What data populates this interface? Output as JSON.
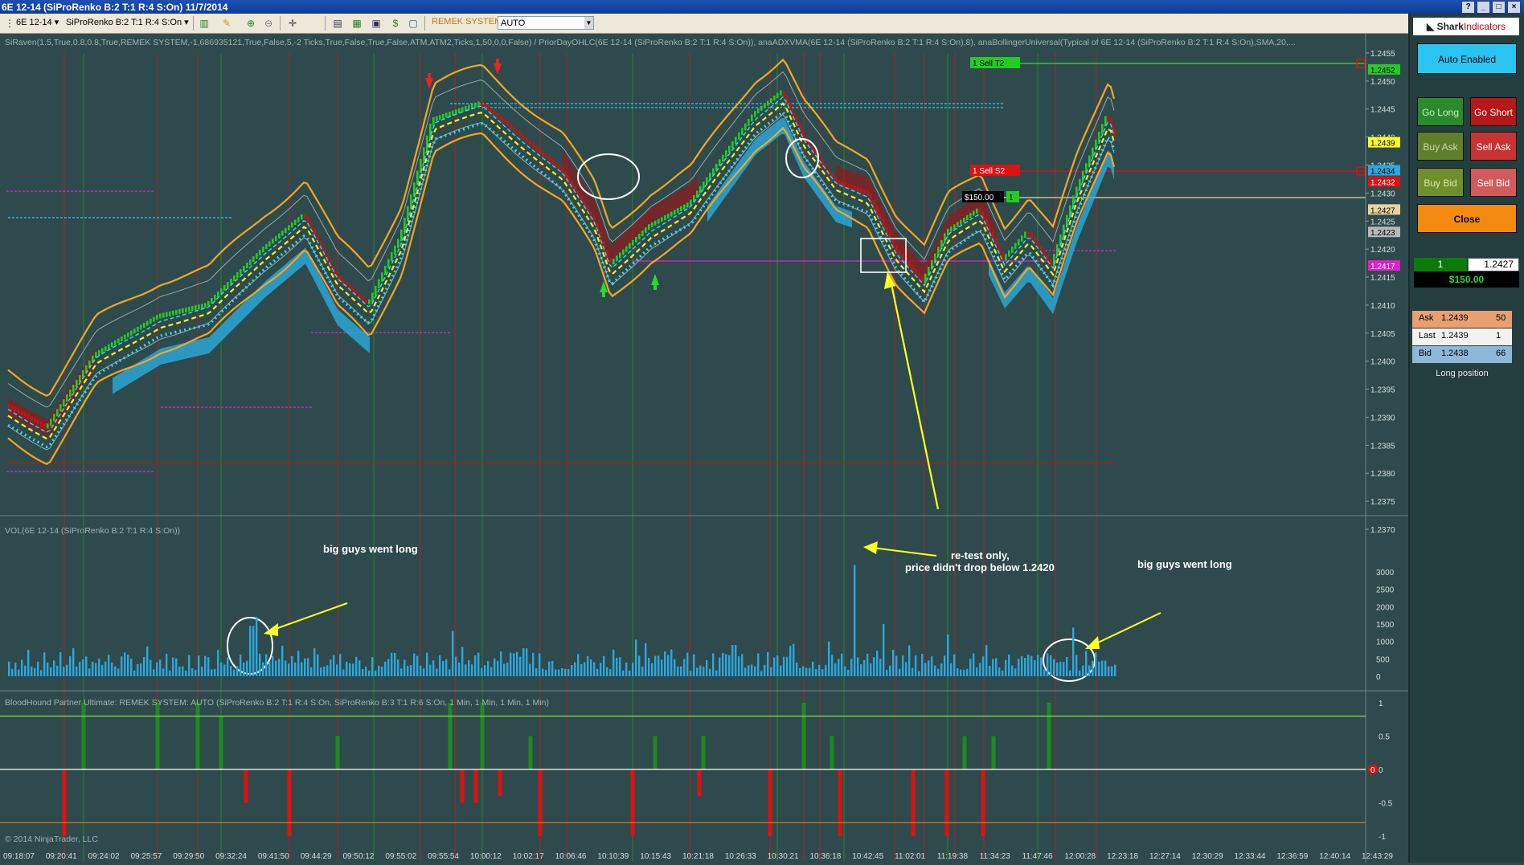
{
  "window": {
    "title": "6E 12-14 (SiProRenko B:2 T:1 R:4 S:On)  11/7/2014",
    "buttons": [
      "?",
      "_",
      "□",
      "×"
    ]
  },
  "toolbar": {
    "instrument": "6E 12-14",
    "chart_type": "SiProRenko B:2 T:1 R:4 S:On",
    "strategy": "REMEK SYSTEM",
    "mode": "AUTO"
  },
  "chart": {
    "indicator_label": "SiRaven(1.5,True,0.8,0.8,True,REMEK SYSTEM,-1,686935121,True,False,5,-2 Ticks,True,False,True,False,ATM,ATM2,Ticks,1,50,0,0,False) / PriorDayOHLC(6E 12-14 (SiProRenko B:2 T:1 R:4 S:On)), anaADXVMA(6E 12-14 (SiProRenko B:2 T:1 R:4 S:On),8), anaBollingerUniversal(Typical of 6E 12-14 (SiProRenko B:2 T:1 R:4 S:On),SMA,20,...",
    "vol_label": "VOL(6E 12-14 (SiProRenko B:2 T:1 R:4 S:On))",
    "bh_label": "BloodHound Partner Ultimate: REMEK SYSTEM: AUTO (SiProRenko B:2 T:1 R:4 S:On, SiProRenko B:3 T:1 R:6 S:On, 1 Min, 1 Min, 1 Min, 1 Min)",
    "copyright": "© 2014 NinjaTrader, LLC",
    "price_ticks": [
      "1.2455",
      "1.2450",
      "1.2445",
      "1.2440",
      "1.2435",
      "1.2430",
      "1.2425",
      "1.2420",
      "1.2415",
      "1.2410",
      "1.2405",
      "1.2400",
      "1.2395",
      "1.2390",
      "1.2385",
      "1.2380",
      "1.2375",
      "1.2370"
    ],
    "price_badges": [
      {
        "value": "1.2452",
        "bg": "#22cc22",
        "fg": "#000"
      },
      {
        "value": "1.2439",
        "bg": "#ffff22",
        "fg": "#000"
      },
      {
        "value": "1.2434",
        "bg": "#2aa8e0",
        "fg": "#000"
      },
      {
        "value": "1.2432",
        "bg": "#dd1111",
        "fg": "#fff"
      },
      {
        "value": "1.2427",
        "bg": "#e8d3a0",
        "fg": "#000"
      },
      {
        "value": "1.2423",
        "bg": "#b8b8b8",
        "fg": "#000"
      },
      {
        "value": "1.2417",
        "bg": "#e020d0",
        "fg": "#fff"
      }
    ],
    "orders": {
      "t2": {
        "qty": "1",
        "label": "Sell T2"
      },
      "s2": {
        "qty": "1",
        "label": "Sell S2"
      },
      "pnl": "$150.00",
      "entry_qty": "1"
    },
    "vol_ticks": [
      "3000",
      "2500",
      "2000",
      "1500",
      "1000",
      "500",
      "0"
    ],
    "bh_ticks": [
      "1",
      "0.5",
      "0",
      "-0.5",
      "-1"
    ],
    "bh_zero_badge": "0",
    "time_labels": [
      "09:18:07",
      "09:20:41",
      "09:24:02",
      "09:25:57",
      "09:29:50",
      "09:32:24",
      "09:41:50",
      "09:44:29",
      "09:50:12",
      "09:55:02",
      "09:55:54",
      "10:00:12",
      "10:02:17",
      "10:06:46",
      "10:10:39",
      "10:15:43",
      "10:21:18",
      "10:26:33",
      "10:30:21",
      "10:36:18",
      "10:42:45",
      "11:02:01",
      "11:19:38",
      "11:34:23",
      "11:47:46",
      "12:00:28",
      "12:23:18",
      "12:27:14",
      "12:30:29",
      "12:33:44",
      "12:36:59",
      "12:40:14",
      "12:43:29"
    ],
    "annotations": {
      "big_guys_1": "big guys went long",
      "big_guys_2": "big guys went long",
      "retest_1": "re-test only,",
      "retest_2": "price didn't drop below 1.2420"
    }
  },
  "panel": {
    "logo_main": "Shark",
    "logo_sub": "Indicators",
    "auto_enabled": "Auto Enabled",
    "go_long": "Go Long",
    "go_short": "Go Short",
    "buy_ask": "Buy Ask",
    "sell_ask": "Sell Ask",
    "buy_bid": "Buy Bid",
    "sell_bid": "Sell Bid",
    "close": "Close",
    "position_qty": "1",
    "position_price": "1.2427",
    "position_pnl": "$150.00",
    "ask": {
      "label": "Ask",
      "price": "1.2439",
      "size": "50"
    },
    "last": {
      "label": "Last",
      "price": "1.2439",
      "size": "1"
    },
    "bid": {
      "label": "Bid",
      "price": "1.2438",
      "size": "66"
    },
    "position_text": "Long position"
  },
  "colors": {
    "background": "#2e4a4c",
    "bull_candle": "#22cc22",
    "bear_candle": "#cc1111",
    "bollinger": "#f5a623",
    "volume": "#2aa8e0"
  }
}
